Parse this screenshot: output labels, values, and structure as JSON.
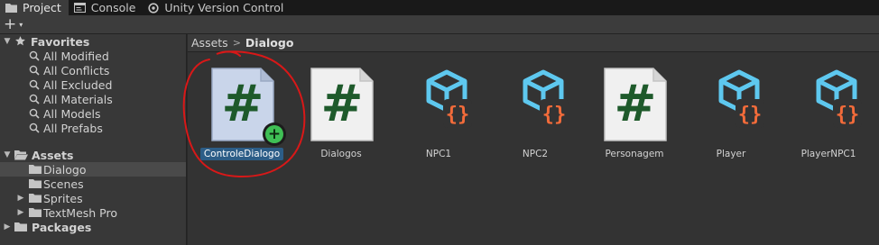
{
  "tabs": [
    {
      "label": "Project",
      "icon": "folder-icon"
    },
    {
      "label": "Console",
      "icon": "console-icon"
    },
    {
      "label": "Unity Version Control",
      "icon": "version-control-icon"
    }
  ],
  "toolbar": {
    "add_label": "+",
    "add_caret": "▾"
  },
  "sidebar": {
    "favorites": {
      "label": "Favorites",
      "items": [
        "All Modified",
        "All Conflicts",
        "All Excluded",
        "All Materials",
        "All Models",
        "All Prefabs"
      ]
    },
    "assets": {
      "label": "Assets",
      "children": [
        "Dialogo",
        "Scenes",
        "Sprites",
        "TextMesh Pro"
      ],
      "selected": "Dialogo"
    },
    "packages": {
      "label": "Packages"
    }
  },
  "breadcrumb": {
    "root": "Assets",
    "separator": ">",
    "current": "Dialogo"
  },
  "assets": [
    {
      "name": "ControleDialogo",
      "type": "script",
      "selected": true,
      "new": true
    },
    {
      "name": "Dialogos",
      "type": "script"
    },
    {
      "name": "NPC1",
      "type": "scriptable"
    },
    {
      "name": "NPC2",
      "type": "scriptable"
    },
    {
      "name": "Personagem",
      "type": "script"
    },
    {
      "name": "Player",
      "type": "scriptable"
    },
    {
      "name": "PlayerNPC1",
      "type": "scriptable"
    }
  ],
  "colors": {
    "selection_label": "#2c5d87",
    "hash_green": "#1e5a2b",
    "cube_blue": "#5ec8ef",
    "braces_orange": "#f26b3a",
    "annotation_red": "#d81818"
  }
}
